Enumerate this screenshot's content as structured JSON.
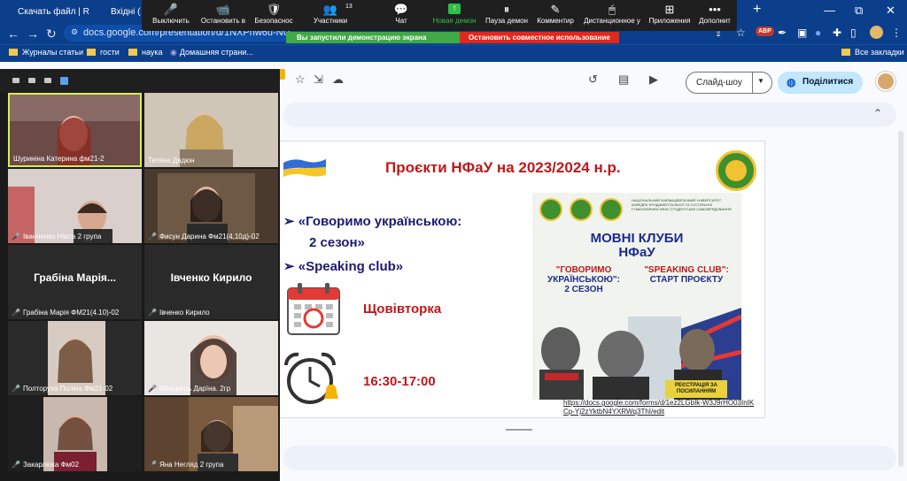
{
  "browser": {
    "tabs": [
      {
        "label": "Скачать файл | R"
      },
      {
        "label": "Вхідні ("
      }
    ],
    "new_tab": "+",
    "window_controls": [
      "—",
      "⧉",
      "✕"
    ],
    "url": "docs.google.com/presentation/d/1NXPhw6u-NU",
    "bookmarks": [
      "Журналы статьи",
      "гости",
      "наука",
      "Домашняя страни...",
      "Все закладки"
    ],
    "ext_badge": "ABP"
  },
  "zoom_toolbar": {
    "participants_count": "13",
    "buttons": [
      {
        "label": "Выключить",
        "icon": "🎤"
      },
      {
        "label": "Остановить в",
        "icon": "📹"
      },
      {
        "label": "Безопаснос",
        "icon": "🛡"
      },
      {
        "label": "Участники",
        "icon": "👥"
      },
      {
        "label": "Чат",
        "icon": "💬"
      },
      {
        "label": "Новая демон",
        "icon": "↑"
      },
      {
        "label": "Пауза демон",
        "icon": "⏸"
      },
      {
        "label": "Комментир",
        "icon": "✎"
      },
      {
        "label": "Дистанционное у",
        "icon": "🖱"
      },
      {
        "label": "Приложения",
        "icon": "⊞"
      },
      {
        "label": "Дополнит",
        "icon": "•••"
      }
    ],
    "notification": "Вы запустили демонстрацию экрана",
    "stop_sharing": "Остановить совместное использование"
  },
  "slides_header": {
    "slideshow_label": "Слайд-шоу",
    "share_label": "Поділитися"
  },
  "slide": {
    "title": "Проєкти НФаУ на 2023/2024 н.р.",
    "bullets": [
      "➢ «Говоримо українською:",
      "2 сезон»",
      "➢ «Speaking club»"
    ],
    "day": "Щовівторка",
    "time": "16:30-17:00",
    "poster": {
      "header": "НАЦІОНАЛЬНИЙ ФАРМАЦЕВТИЧНИЙ УНІВЕРСИТЕТ КАФЕДРА ФУНДАМЕНТАЛЬНОЇ ТА СУСПІЛЬНОЇ ГУМАНІТАРИКИ НФАУ СТУДЕНТСЬКЕ САМОВРЯДУВАННЯ",
      "title_line1": "МОВНІ КЛУБИ",
      "title_line2": "НФаУ",
      "left_line1": "\"ГОВОРИМО",
      "left_line2": "УКРАЇНСЬКОЮ\":",
      "left_line3": "2 СЕЗОН",
      "right_line1": "\"SPEAKING CLUB\":",
      "right_line2": "СТАРТ ПРОЄКТУ",
      "register": "РЕЄСТРАЦІЯ ЗА ПОСИЛАННЯМ"
    },
    "link": "https://docs.google.com/forms/d/1ez2LGbIk-W3J9rHO03InIKCp-Yj2zYktbN4YXRWq3ThI/edit"
  },
  "participants": [
    {
      "name": "Шуриніна Катерина фм21-2",
      "video": true,
      "muted": false,
      "speaking": true
    },
    {
      "name": "Тетяна Дядюн",
      "video": true,
      "muted": false,
      "speaking": false
    },
    {
      "name": "Іванченко Нікіта 2 група",
      "video": true,
      "muted": true,
      "speaking": false
    },
    {
      "name": "Фисун Дарина Фм21(4,10д)-02",
      "video": true,
      "muted": true,
      "speaking": false
    },
    {
      "name": "Грабіна Марія ФМ21(4.10)-02",
      "big_name": "Грабіна Марія...",
      "video": false,
      "muted": true
    },
    {
      "name": "Івченко Кирило",
      "big_name": "Івченко Кирило",
      "video": false,
      "muted": true
    },
    {
      "name": "Полторуха Поліна Фм21-02",
      "video": true,
      "muted": true
    },
    {
      "name": "Мазурець Дарїна. 2гр",
      "video": true,
      "muted": true
    },
    {
      "name": "Закарлюка Фм02",
      "video": true,
      "muted": true
    },
    {
      "name": "Яна Негляд 2 група",
      "video": true,
      "muted": true
    }
  ],
  "colors": {
    "chrome_blue": "#0b3f8c",
    "zoom_green": "#40a845",
    "zoom_red": "#e0281c",
    "slide_title_red": "#c0171b",
    "slide_text_navy": "#1b1b6e",
    "active_speaker": "#d6f24a"
  }
}
